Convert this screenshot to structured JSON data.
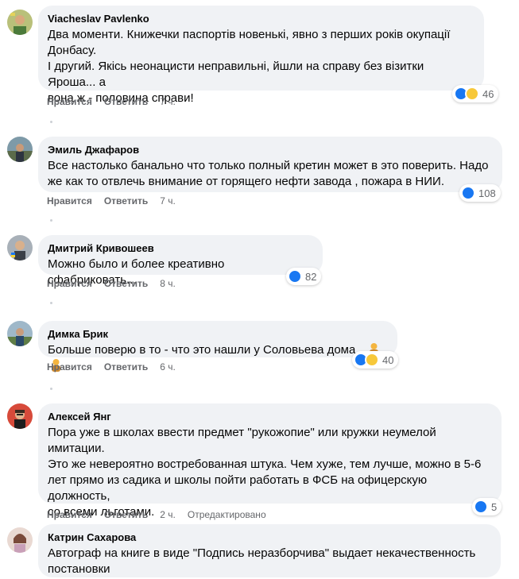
{
  "colors": {
    "like_blue": "#1877f2",
    "haha_yellow": "#f7c83a",
    "bubble_bg": "#f0f2f5",
    "meta_gray": "#65676b"
  },
  "comments": [
    {
      "author": "Viacheslav Pavlenko",
      "text": "Два моменти. Книжечки паспортів новенькі, явно з перших років окупації\nДонбасу.\nІ другий. Якісь неонацисти неправильні, йшли на справу без візитки Яроша... а\nвона ж - половина справи!",
      "like_label": "Нравится",
      "reply_label": "Ответить",
      "time": "7 ч.",
      "reactions": [
        "like-icon",
        "haha-icon"
      ],
      "reaction_count": "46"
    },
    {
      "author": "Эмиль Джафаров",
      "text": "Все настолько банально что только полный кретин может в это поверить. Надо\nже как то отвлечь внимание от горящего нефти завода , пожара в НИИ.",
      "like_label": "Нравится",
      "reply_label": "Ответить",
      "time": "7 ч.",
      "reactions": [
        "like-icon"
      ],
      "reaction_count": "108"
    },
    {
      "author": "Дмитрий Кривошеев",
      "text": "Можно было и более креативно сфабриковать...",
      "like_label": "Нравится",
      "reply_label": "Ответить",
      "time": "8 ч.",
      "reactions": [
        "like-icon"
      ],
      "reaction_count": "82"
    },
    {
      "author": "Димка Брик",
      "text": "Больше поверю в то - что это нашли у Соловьева дома...",
      "text_emoji": [
        "person-shrugging-emoji",
        "person-shrugging-emoji"
      ],
      "like_label": "Нравится",
      "reply_label": "Ответить",
      "time": "6 ч.",
      "reactions": [
        "like-icon",
        "haha-icon"
      ],
      "reaction_count": "40"
    },
    {
      "author": "Алексей Янг",
      "text": "Пора уже в школах ввести предмет \"рукожопие\" или кружки неумелой\nимитации.\nЭто же невероятно востребованная штука. Чем хуже, тем лучше, можно в 5-6\nлет прямо из садика и школы пойти работать в ФСБ на офицерскую должность,\nсо всеми льготами.",
      "like_label": "Нравится",
      "reply_label": "Ответить",
      "time": "2 ч.",
      "edited_label": "Отредактировано",
      "reactions": [
        "like-icon"
      ],
      "reaction_count": "5"
    },
    {
      "author": "Катрин Сахарова",
      "text": "Автограф на книге в виде \"Подпись неразборчива\" выдает некачественность\nпостановки"
    }
  ]
}
